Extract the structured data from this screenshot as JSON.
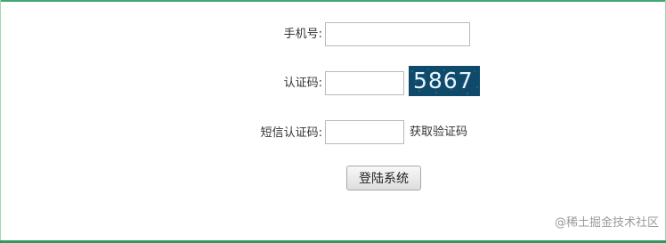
{
  "form": {
    "phone_label": "手机号:",
    "phone_value": "",
    "captcha_label": "认证码:",
    "captcha_value": "",
    "captcha_image_text": "5867",
    "sms_label": "短信认证码:",
    "sms_value": "",
    "get_code_label": "获取验证码",
    "login_label": "登陆系统"
  },
  "watermark": "@稀土掘金技术社区",
  "colors": {
    "frame_green": "#3ea86f",
    "captcha_bg": "#0f4a6b",
    "captcha_text": "#e8f4ff"
  }
}
